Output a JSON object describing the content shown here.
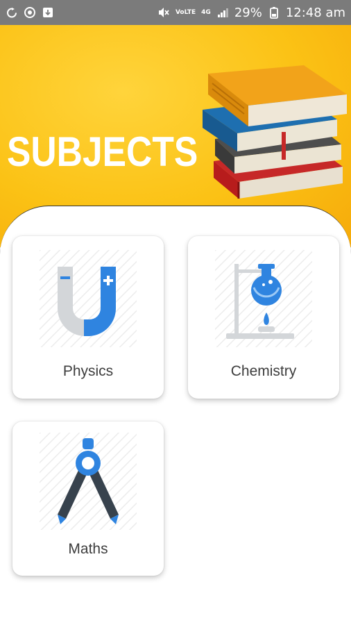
{
  "status_bar": {
    "net_top": "VoLTE",
    "net_label": "4G",
    "battery": "29%",
    "time": "12:48 am",
    "icons": [
      "sync-icon",
      "sync-alt-icon",
      "download-icon",
      "mute-icon",
      "volte-icon",
      "4g-icon",
      "signal-icon",
      "battery-icon"
    ]
  },
  "header": {
    "title": "SUBJECTS",
    "image": "stack-of-books-illustration",
    "background_color": "#fbc215"
  },
  "subjects": [
    {
      "label": "Physics",
      "icon": "magnet-icon"
    },
    {
      "label": "Chemistry",
      "icon": "flask-icon"
    },
    {
      "label": "Maths",
      "icon": "compass-icon"
    }
  ],
  "colors": {
    "accent_blue": "#2f84e0",
    "dark_slate": "#37424d",
    "grey": "#d3d6d9"
  }
}
